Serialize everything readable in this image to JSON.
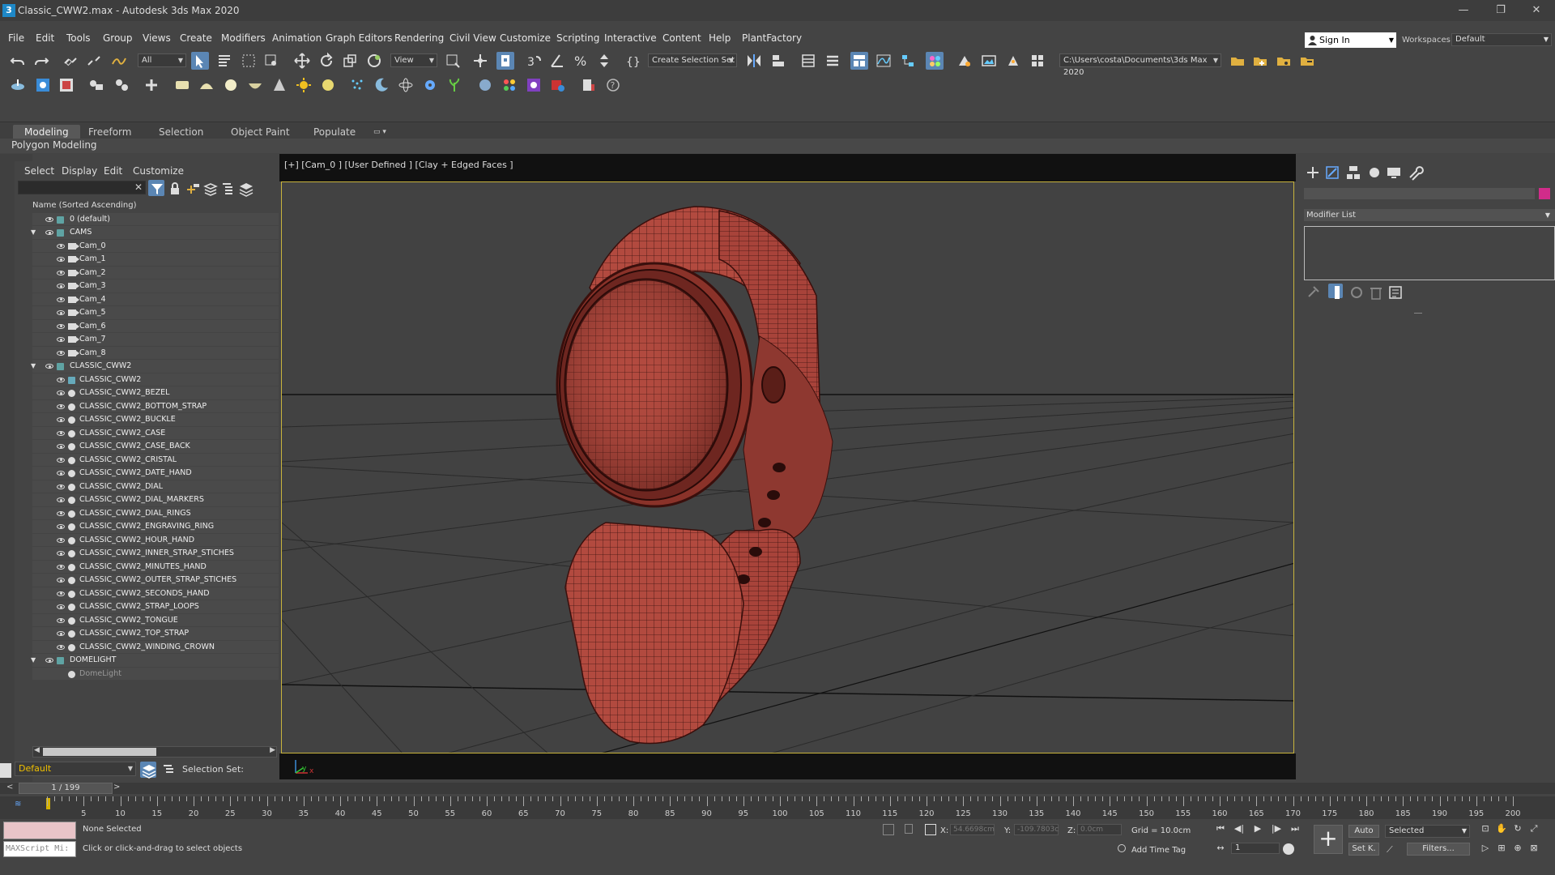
{
  "window": {
    "title": "Classic_CWW2.max - Autodesk 3ds Max 2020",
    "app_icon": "3",
    "minimize": "—",
    "restore": "❐",
    "close": "✕"
  },
  "menu": [
    "File",
    "Edit",
    "Tools",
    "Group",
    "Views",
    "Create",
    "Modifiers",
    "Animation",
    "Graph Editors",
    "Rendering",
    "Civil View",
    "Customize",
    "Scripting",
    "Interactive",
    "Content",
    "Help",
    "PlantFactory"
  ],
  "account": {
    "signin": "Sign In",
    "workspaces_label": "Workspaces:",
    "workspace": "Default"
  },
  "toolbar": {
    "filter": "All",
    "refcoord": "View",
    "selset": "Create Selection Set",
    "project_path": "C:\\Users\\costa\\Documents\\3ds Max 2020"
  },
  "ribbon": {
    "tabs": [
      "Modeling",
      "Freeform",
      "Selection",
      "Object Paint",
      "Populate"
    ],
    "active_tab": "Modeling",
    "sub": "Polygon Modeling"
  },
  "scene_explorer": {
    "menu": [
      "Select",
      "Display",
      "Edit",
      "Customize"
    ],
    "header": "Name (Sorted Ascending)",
    "rows": [
      {
        "label": "0 (default)",
        "indent": 0,
        "type": "layer",
        "expand": ""
      },
      {
        "label": "CAMS",
        "indent": 0,
        "type": "layer",
        "expand": "▼"
      },
      {
        "label": "Cam_0",
        "indent": 1,
        "type": "cam",
        "expand": ""
      },
      {
        "label": "Cam_1",
        "indent": 1,
        "type": "cam",
        "expand": ""
      },
      {
        "label": "Cam_2",
        "indent": 1,
        "type": "cam",
        "expand": ""
      },
      {
        "label": "Cam_3",
        "indent": 1,
        "type": "cam",
        "expand": ""
      },
      {
        "label": "Cam_4",
        "indent": 1,
        "type": "cam",
        "expand": ""
      },
      {
        "label": "Cam_5",
        "indent": 1,
        "type": "cam",
        "expand": ""
      },
      {
        "label": "Cam_6",
        "indent": 1,
        "type": "cam",
        "expand": ""
      },
      {
        "label": "Cam_7",
        "indent": 1,
        "type": "cam",
        "expand": ""
      },
      {
        "label": "Cam_8",
        "indent": 1,
        "type": "cam",
        "expand": ""
      },
      {
        "label": "CLASSIC_CWW2",
        "indent": 0,
        "type": "layer",
        "expand": "▼"
      },
      {
        "label": "CLASSIC_CWW2",
        "indent": 1,
        "type": "group",
        "expand": ""
      },
      {
        "label": "CLASSIC_CWW2_BEZEL",
        "indent": 1,
        "type": "obj",
        "expand": ""
      },
      {
        "label": "CLASSIC_CWW2_BOTTOM_STRAP",
        "indent": 1,
        "type": "obj",
        "expand": ""
      },
      {
        "label": "CLASSIC_CWW2_BUCKLE",
        "indent": 1,
        "type": "obj",
        "expand": ""
      },
      {
        "label": "CLASSIC_CWW2_CASE",
        "indent": 1,
        "type": "obj",
        "expand": ""
      },
      {
        "label": "CLASSIC_CWW2_CASE_BACK",
        "indent": 1,
        "type": "obj",
        "expand": ""
      },
      {
        "label": "CLASSIC_CWW2_CRISTAL",
        "indent": 1,
        "type": "obj",
        "expand": ""
      },
      {
        "label": "CLASSIC_CWW2_DATE_HAND",
        "indent": 1,
        "type": "obj",
        "expand": ""
      },
      {
        "label": "CLASSIC_CWW2_DIAL",
        "indent": 1,
        "type": "obj",
        "expand": ""
      },
      {
        "label": "CLASSIC_CWW2_DIAL_MARKERS",
        "indent": 1,
        "type": "obj",
        "expand": ""
      },
      {
        "label": "CLASSIC_CWW2_DIAL_RINGS",
        "indent": 1,
        "type": "obj",
        "expand": ""
      },
      {
        "label": "CLASSIC_CWW2_ENGRAVING_RING",
        "indent": 1,
        "type": "obj",
        "expand": ""
      },
      {
        "label": "CLASSIC_CWW2_HOUR_HAND",
        "indent": 1,
        "type": "obj",
        "expand": ""
      },
      {
        "label": "CLASSIC_CWW2_INNER_STRAP_STICHES",
        "indent": 1,
        "type": "obj",
        "expand": ""
      },
      {
        "label": "CLASSIC_CWW2_MINUTES_HAND",
        "indent": 1,
        "type": "obj",
        "expand": ""
      },
      {
        "label": "CLASSIC_CWW2_OUTER_STRAP_STICHES",
        "indent": 1,
        "type": "obj",
        "expand": ""
      },
      {
        "label": "CLASSIC_CWW2_SECONDS_HAND",
        "indent": 1,
        "type": "obj",
        "expand": ""
      },
      {
        "label": "CLASSIC_CWW2_STRAP_LOOPS",
        "indent": 1,
        "type": "obj",
        "expand": ""
      },
      {
        "label": "CLASSIC_CWW2_TONGUE",
        "indent": 1,
        "type": "obj",
        "expand": ""
      },
      {
        "label": "CLASSIC_CWW2_TOP_STRAP",
        "indent": 1,
        "type": "obj",
        "expand": ""
      },
      {
        "label": "CLASSIC_CWW2_WINDING_CROWN",
        "indent": 1,
        "type": "obj",
        "expand": ""
      },
      {
        "label": "DOMELIGHT",
        "indent": 0,
        "type": "layer",
        "expand": "▼"
      },
      {
        "label": "DomeLight",
        "indent": 1,
        "type": "light",
        "expand": "",
        "dim": true
      }
    ],
    "layer": "Default",
    "selection_set_label": "Selection Set:"
  },
  "viewport": {
    "label": "[+] [Cam_0 ] [User Defined ] [Clay + Edged Faces ]",
    "axis_x": "x",
    "axis_y": "y"
  },
  "command_panel": {
    "modifier_list": "Modifier List",
    "color": "#d12c8a"
  },
  "timeline": {
    "frame": "1 / 199",
    "prev": "<",
    "next": ">",
    "ticks": [
      5,
      10,
      15,
      20,
      25,
      30,
      35,
      40,
      45,
      50,
      55,
      60,
      65,
      70,
      75,
      80,
      85,
      90,
      95,
      100,
      105,
      110,
      115,
      120,
      125,
      130,
      135,
      140,
      145,
      150,
      155,
      160,
      165,
      170,
      175,
      180,
      185,
      190,
      195,
      200
    ]
  },
  "status": {
    "maxscript": "MAXScript Mi:",
    "selected": "None Selected",
    "prompt": "Click or click-and-drag to select objects",
    "x_label": "X:",
    "x": "54.6698cm",
    "y_label": "Y:",
    "y": "-109.7803c",
    "z_label": "Z:",
    "z": "0.0cm",
    "grid": "Grid = 10.0cm",
    "add_time_tag": "Add Time Tag",
    "auto": "Auto",
    "setkey": "Set K.",
    "key_mode": "Selected",
    "filters": "Filters...",
    "frame_field": "1"
  },
  "colors": {
    "accent": "#5b86b4",
    "viewport_border": "#c9b43d",
    "mesh": "#b5443a",
    "wire": "#3a0f0c"
  }
}
